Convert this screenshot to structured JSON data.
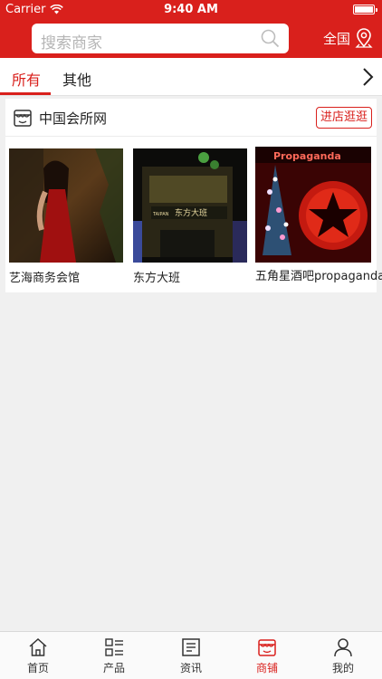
{
  "status_bar": {
    "carrier": "Carrier",
    "time": "9:40 AM"
  },
  "header": {
    "search_placeholder": "搜索商家",
    "location_label": "全国"
  },
  "tabs": [
    {
      "label": "所有",
      "active": true
    },
    {
      "label": "其他",
      "active": false
    }
  ],
  "shop": {
    "name": "中国会所网",
    "visit_button": "进店逛逛",
    "products": [
      {
        "name": "艺海商务会馆",
        "image": "woman-in-red-dress-photo"
      },
      {
        "name": "东方大班",
        "image": "night-building-facade-photo",
        "sign_text": "东方大班"
      },
      {
        "name": "五角星酒吧propaganda",
        "image": "red-star-bar-photo",
        "sign_text": "Propaganda"
      }
    ]
  },
  "tabbar": [
    {
      "label": "首页",
      "icon": "home-icon",
      "active": false
    },
    {
      "label": "产品",
      "icon": "grid-list-icon",
      "active": false
    },
    {
      "label": "资讯",
      "icon": "news-icon",
      "active": false
    },
    {
      "label": "商铺",
      "icon": "store-icon",
      "active": true
    },
    {
      "label": "我的",
      "icon": "user-icon",
      "active": false
    }
  ],
  "colors": {
    "accent": "#d9201c",
    "background": "#f0f0f0"
  }
}
